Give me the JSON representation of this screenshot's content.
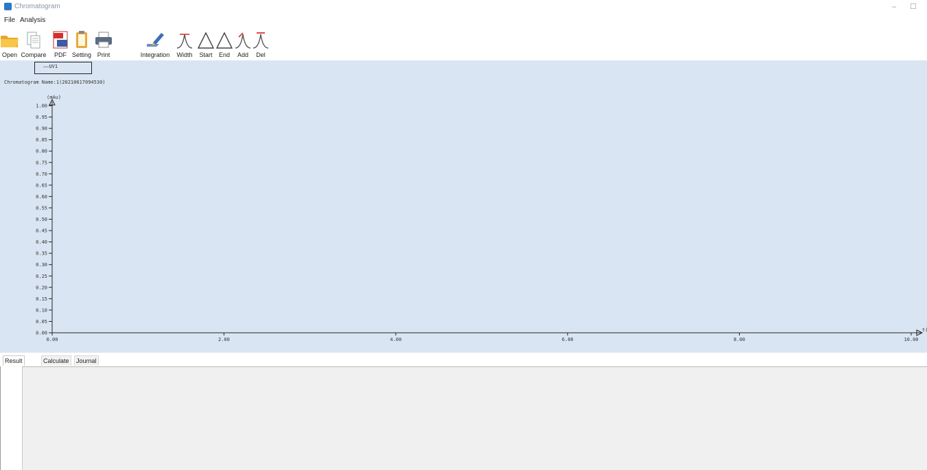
{
  "window": {
    "title": "Chromatogram",
    "minimize": "–",
    "maximize": "☐"
  },
  "menu": {
    "items": [
      {
        "label": "File"
      },
      {
        "label": "Analysis"
      }
    ]
  },
  "toolbar": {
    "items": [
      {
        "label": "Open",
        "icon": "folder-icon"
      },
      {
        "label": "Compare",
        "icon": "compare-documents-icon"
      },
      {
        "label": "PDF",
        "icon": "pdf-icon"
      },
      {
        "label": "Setting",
        "icon": "clipboard-icon"
      },
      {
        "label": "Print",
        "icon": "printer-icon"
      },
      {
        "label": "Integration",
        "icon": "integration-pen-icon"
      },
      {
        "label": "Width",
        "icon": "peak-width-icon"
      },
      {
        "label": "Start",
        "icon": "peak-start-icon"
      },
      {
        "label": "End",
        "icon": "peak-end-icon"
      },
      {
        "label": "Add",
        "icon": "peak-add-icon"
      },
      {
        "label": "Del",
        "icon": "peak-delete-icon"
      }
    ]
  },
  "chart": {
    "legend_label": "UV1",
    "chromatogram_name": "Chromatogram Name:1(20210617094530)"
  },
  "chart_data": {
    "type": "line",
    "title": "",
    "xlabel": "t(min)",
    "ylabel": "(mAu)",
    "xlim": [
      0,
      10
    ],
    "ylim": [
      0,
      1
    ],
    "x_ticks": [
      "0.00",
      "2.00",
      "4.00",
      "6.00",
      "8.00",
      "10.00"
    ],
    "y_ticks": [
      "0.00",
      "0.05",
      "0.10",
      "0.15",
      "0.20",
      "0.25",
      "0.30",
      "0.35",
      "0.40",
      "0.45",
      "0.50",
      "0.55",
      "0.60",
      "0.65",
      "0.70",
      "0.75",
      "0.80",
      "0.85",
      "0.90",
      "0.95",
      "1.00"
    ],
    "series": [
      {
        "name": "UV1",
        "x": [],
        "y": []
      }
    ],
    "grid": false,
    "legend_position": "top-left",
    "colors": {
      "axis": "#222222",
      "background": "#d9e5f2"
    }
  },
  "tabs": [
    {
      "label": "Result"
    },
    {
      "label": "Calculate"
    },
    {
      "label": "Journal"
    }
  ]
}
